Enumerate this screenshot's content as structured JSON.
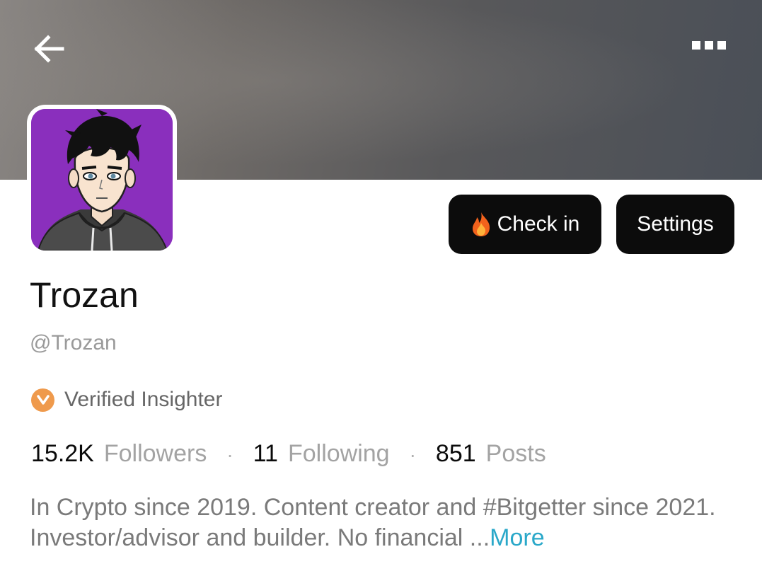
{
  "header": {
    "back_icon": "arrow-left-icon",
    "more_icon": "more-dots-icon"
  },
  "profile": {
    "avatar_bg": "#8a2fbd",
    "name": "Trozan",
    "handle": "@Trozan",
    "badge": {
      "icon": "verified-v-icon",
      "color": "#ef9a4c",
      "label": "Verified Insighter"
    }
  },
  "actions": {
    "checkin": {
      "icon": "fire-icon",
      "label": "Check in"
    },
    "settings_label": "Settings"
  },
  "stats": {
    "followers": {
      "value": "15.2K",
      "label": "Followers"
    },
    "following": {
      "value": "11",
      "label": "Following"
    },
    "posts": {
      "value": "851",
      "label": "Posts"
    },
    "separator": "·"
  },
  "bio": {
    "text": "In Crypto since 2019. Content creator and #Bitgetter since 2021. Investor/advisor and builder. No financial ...",
    "more_label": "More",
    "more_color": "#2aa8c9"
  }
}
